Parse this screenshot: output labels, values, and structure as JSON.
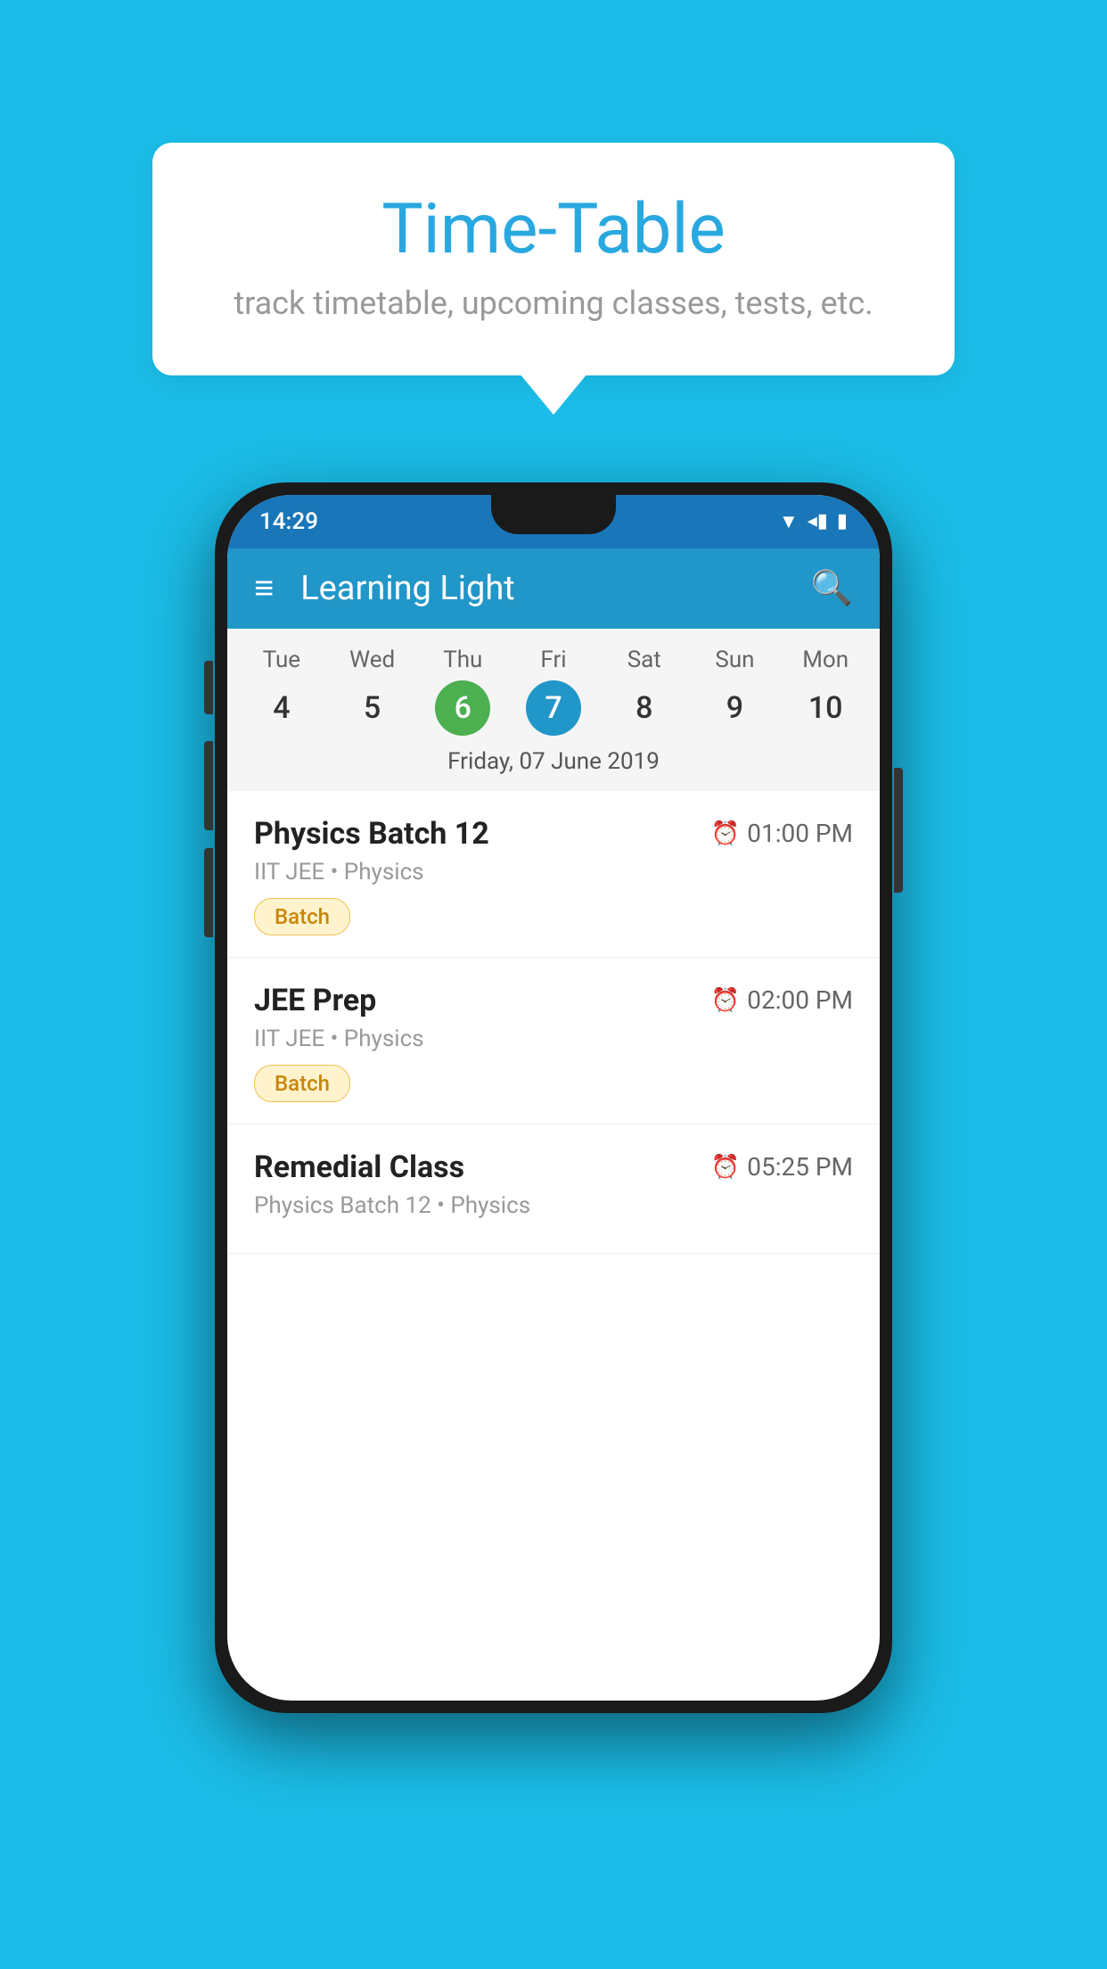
{
  "background_color": "#1BBDE8",
  "tooltip": {
    "title": "Time-Table",
    "subtitle": "track timetable, upcoming classes, tests, etc."
  },
  "phone": {
    "status_bar": {
      "time": "14:29",
      "icons": [
        "▼",
        "◂",
        "▮"
      ]
    },
    "app_bar": {
      "title": "Learning Light",
      "menu_icon": "≡",
      "search_icon": "🔍"
    },
    "calendar": {
      "days": [
        {
          "name": "Tue",
          "num": "4",
          "state": "normal"
        },
        {
          "name": "Wed",
          "num": "5",
          "state": "normal"
        },
        {
          "name": "Thu",
          "num": "6",
          "state": "today"
        },
        {
          "name": "Fri",
          "num": "7",
          "state": "selected"
        },
        {
          "name": "Sat",
          "num": "8",
          "state": "normal"
        },
        {
          "name": "Sun",
          "num": "9",
          "state": "normal"
        },
        {
          "name": "Mon",
          "num": "10",
          "state": "normal"
        }
      ],
      "selected_date_label": "Friday, 07 June 2019"
    },
    "schedule": [
      {
        "title": "Physics Batch 12",
        "time": "01:00 PM",
        "subtitle": "IIT JEE • Physics",
        "badge": "Batch"
      },
      {
        "title": "JEE Prep",
        "time": "02:00 PM",
        "subtitle": "IIT JEE • Physics",
        "badge": "Batch"
      },
      {
        "title": "Remedial Class",
        "time": "05:25 PM",
        "subtitle": "Physics Batch 12 • Physics",
        "badge": ""
      }
    ]
  }
}
